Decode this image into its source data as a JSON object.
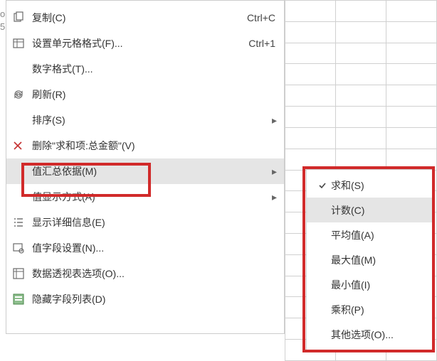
{
  "leftFragmentTop": "o",
  "leftFragmentBottom": "5",
  "mainMenu": {
    "copy": {
      "label": "复制(C)",
      "shortcut": "Ctrl+C"
    },
    "formatCells": {
      "label": "设置单元格格式(F)...",
      "shortcut": "Ctrl+1"
    },
    "numberFormat": {
      "label": "数字格式(T)..."
    },
    "refresh": {
      "label": "刷新(R)"
    },
    "sort": {
      "label": "排序(S)"
    },
    "remove": {
      "label": "删除\"求和项:总金额\"(V)"
    },
    "summarizeBy": {
      "label": "值汇总依据(M)"
    },
    "showValuesAs": {
      "label": "值显示方式(A)"
    },
    "showDetails": {
      "label": "显示详细信息(E)"
    },
    "fieldSettings": {
      "label": "值字段设置(N)..."
    },
    "pivotOptions": {
      "label": "数据透视表选项(O)..."
    },
    "hideFieldList": {
      "label": "隐藏字段列表(D)"
    }
  },
  "subMenu": {
    "sum": {
      "label": "求和(S)",
      "checked": true
    },
    "count": {
      "label": "计数(C)",
      "checked": false,
      "hovered": true
    },
    "average": {
      "label": "平均值(A)",
      "checked": false
    },
    "max": {
      "label": "最大值(M)",
      "checked": false
    },
    "min": {
      "label": "最小值(I)",
      "checked": false
    },
    "product": {
      "label": "乘积(P)",
      "checked": false
    },
    "more": {
      "label": "其他选项(O)...",
      "checked": false
    }
  }
}
